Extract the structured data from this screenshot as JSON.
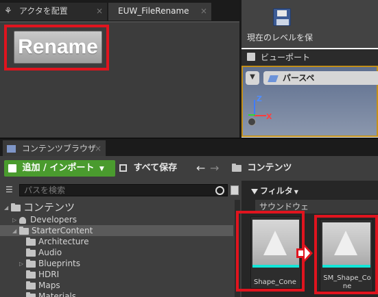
{
  "tabs": [
    {
      "label": "アクタを配置",
      "close": "×"
    },
    {
      "label": "EUW_FileRename",
      "close": "×"
    }
  ],
  "widget": {
    "rename_label": "Rename"
  },
  "toolbar_right": {
    "save_level_label": "現在のレベルを保"
  },
  "viewport": {
    "tab_label": "ビューポート",
    "perspective_label": "パースペ",
    "axis_z": "Z",
    "axis_x": "X"
  },
  "content_browser": {
    "tab_label": "コンテンツブラウザ",
    "tab_close": "×",
    "add_import_label": "追加 / インポート",
    "save_all_label": "すべて保存",
    "back_glyph": "←",
    "forward_glyph": "→",
    "path_root_label": "コンテンツ",
    "search_placeholder": "パスを検索",
    "filter_label": "フィルタ",
    "filter_item_label": "サウンドウェ",
    "tree": [
      {
        "label": "コンテンツ",
        "level": 0,
        "expanded": true
      },
      {
        "label": "Developers",
        "level": 1,
        "expandable": true
      },
      {
        "label": "StarterContent",
        "level": 1,
        "expanded": true,
        "selected": true
      },
      {
        "label": "Architecture",
        "level": 2
      },
      {
        "label": "Audio",
        "level": 2
      },
      {
        "label": "Blueprints",
        "level": 2,
        "expandable": true
      },
      {
        "label": "HDRI",
        "level": 2
      },
      {
        "label": "Maps",
        "level": 2
      },
      {
        "label": "Materials",
        "level": 2
      }
    ],
    "assets": [
      {
        "label": "Shape_Cone"
      },
      {
        "label": "SM_Shape_Cone"
      }
    ]
  },
  "colors": {
    "highlight_red": "#e0141e",
    "add_button_green": "#4a9b2e",
    "asset_teal": "#13e6d8"
  },
  "icons": [
    "place-actors-icon",
    "widget-icon",
    "save-disk-icon",
    "viewport-icon",
    "dropdown-icon",
    "perspective-icon",
    "content-browser-icon",
    "add-icon",
    "save-all-icon",
    "folder-icon",
    "search-icon",
    "filter-icon",
    "user-icon",
    "arrow-right-icon"
  ]
}
